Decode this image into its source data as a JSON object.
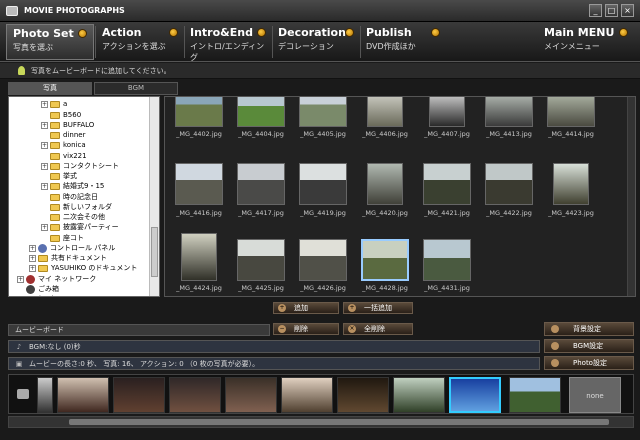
{
  "window": {
    "title": "MOVIE PHOTOGRAPHS",
    "min": "_",
    "max": "□",
    "close": "×"
  },
  "tabs": [
    {
      "title": "Photo Set",
      "subtitle": "写真を選ぶ"
    },
    {
      "title": "Action",
      "subtitle": "アクションを選ぶ"
    },
    {
      "title": "Intro&End",
      "subtitle": "イントロ/エンディング"
    },
    {
      "title": "Decoration",
      "subtitle": "デコレーション"
    },
    {
      "title": "Publish",
      "subtitle": "DVD作成ほか"
    },
    {
      "title": "Main MENU",
      "subtitle": "メインメニュー"
    }
  ],
  "info": {
    "text": "写真をムービーボードに追加してください。"
  },
  "subtabs": [
    "写真",
    "BGM"
  ],
  "tree": [
    "a",
    "B560",
    "BUFFALO",
    "dinner",
    "konica",
    "vix221",
    "コンタクトシート",
    "挙式",
    "結婚式9・15",
    "時の記念日",
    "新しいフォルダ",
    "二次会その他",
    "披露宴パーティー",
    "座コト",
    "コントロール パネル",
    "共有ドキュメント",
    "YASUHIKO のドキュメント",
    "マイ ネットワーク",
    "ごみ箱",
    "konica"
  ],
  "photos": [
    "_MG_4402.jpg",
    "_MG_4404.jpg",
    "_MG_4405.jpg",
    "_MG_4406.jpg",
    "_MG_4407.jpg",
    "_MG_4413.jpg",
    "_MG_4414.jpg",
    "_MG_4416.jpg",
    "_MG_4417.jpg",
    "_MG_4419.jpg",
    "_MG_4420.jpg",
    "_MG_4421.jpg",
    "_MG_4422.jpg",
    "_MG_4423.jpg",
    "_MG_4424.jpg",
    "_MG_4425.jpg",
    "_MG_4426.jpg",
    "_MG_4428.jpg",
    "_MG_4431.jpg"
  ],
  "buttons": {
    "add": "追加",
    "add_all": "一括追加",
    "delete": "削除",
    "delete_all": "全削除"
  },
  "movieboard": {
    "label": "ムービーボード",
    "bgm": "BGM:なし (0)秒",
    "status": "ムービーの長さ:0 秒、 写真: 16、 アクション: 0 （0 枚の写真が必要）。",
    "bg_setting": "背景設定",
    "bgm_setting": "BGM設定",
    "photo_setting": "Photo設定",
    "none": "none"
  },
  "colors": {
    "selected": "#33ccff",
    "accent": "#f0a020"
  }
}
